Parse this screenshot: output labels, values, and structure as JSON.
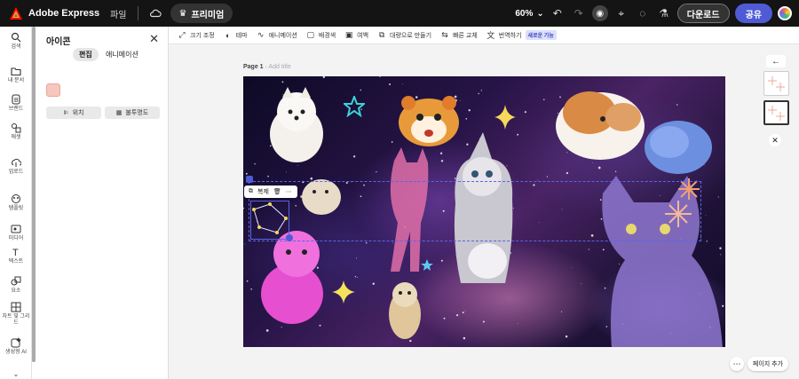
{
  "topbar": {
    "brand": "Adobe Express",
    "file_menu": "파일",
    "premium": "프리미엄",
    "zoom": "60%",
    "download": "다운로드",
    "share": "공유"
  },
  "rail": [
    {
      "label": "검색",
      "icon": "search-icon"
    },
    {
      "label": "내 문서",
      "icon": "folder-icon"
    },
    {
      "label": "브랜드",
      "icon": "brand-icon"
    },
    {
      "label": "애셋",
      "icon": "shapes-icon"
    },
    {
      "label": "업로드",
      "icon": "upload-icon"
    },
    {
      "label": "템플릿",
      "icon": "template-icon"
    },
    {
      "label": "미디어",
      "icon": "media-icon"
    },
    {
      "label": "텍스트",
      "icon": "text-icon"
    },
    {
      "label": "요소",
      "icon": "elements-icon"
    },
    {
      "label": "차트 및 그리드",
      "icon": "grid-icon"
    },
    {
      "label": "생성형 AI",
      "icon": "ai-icon"
    }
  ],
  "panel": {
    "title": "아이콘",
    "tab_edit": "편집",
    "tab_animation": "애니메이션",
    "swatch_color": "#f7c6bc",
    "btn_position": "위치",
    "btn_opacity": "불투명도"
  },
  "toolbar2": {
    "resize": "크기 조정",
    "theme": "테마",
    "animation": "애니메이션",
    "background": "배경색",
    "margin": "여백",
    "make_from_doc": "대량으로 만들기",
    "quick_replace": "빠른 교체",
    "translate": "번역하기",
    "new_badge": "새로운 기능"
  },
  "canvas": {
    "page": "Page 1",
    "title_placeholder": "Add title",
    "ctx_copy": "복제"
  },
  "right": {
    "add_page": "페이지 추가"
  },
  "colors": {
    "accent": "#4f5bd5",
    "topbar": "#141414"
  }
}
